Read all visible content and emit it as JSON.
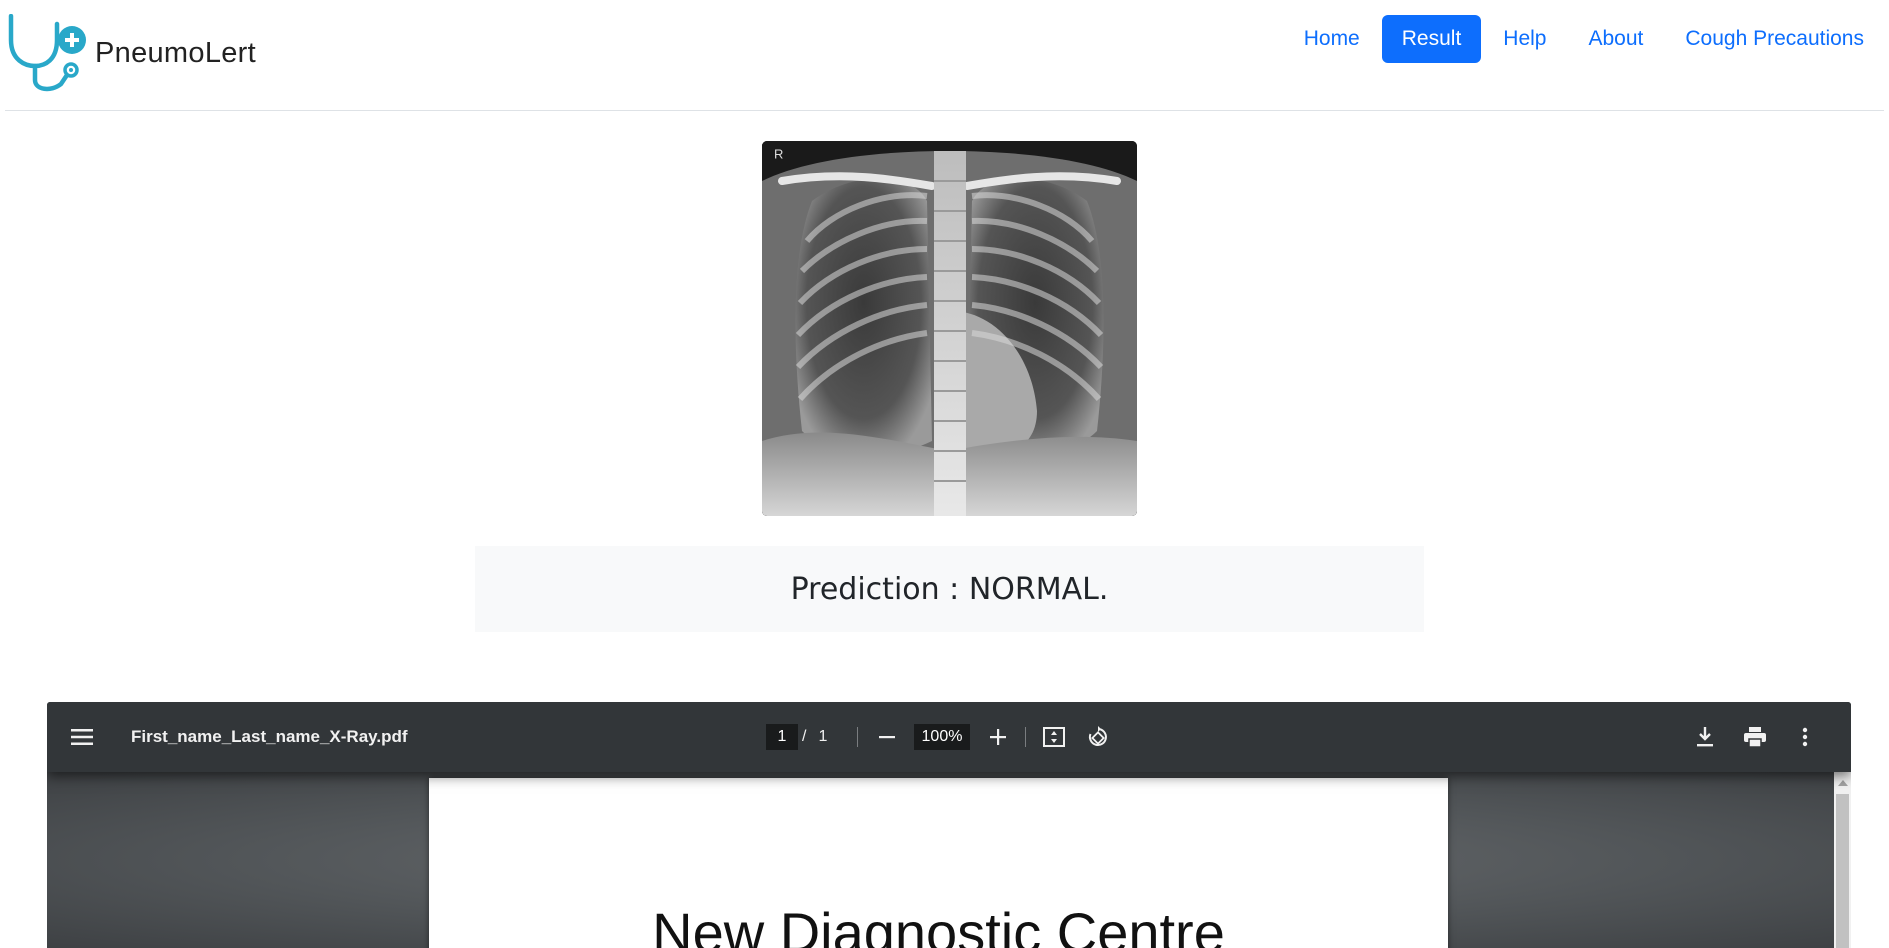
{
  "brand": {
    "name": "PneumoLert",
    "logo_icon": "stethoscope-plus-icon",
    "logo_color": "#29a8c9"
  },
  "nav": {
    "items": [
      {
        "label": "Home",
        "active": false
      },
      {
        "label": "Result",
        "active": true
      },
      {
        "label": "Help",
        "active": false
      },
      {
        "label": "About",
        "active": false
      },
      {
        "label": "Cough Precautions",
        "active": false
      }
    ],
    "accent": "#0d6efd"
  },
  "xray": {
    "marker": "R"
  },
  "prediction": {
    "text": "Prediction : NORMAL."
  },
  "pdf_viewer": {
    "filename": "First_name_Last_name_X-Ray.pdf",
    "current_page": "1",
    "total_pages": "1",
    "zoom": "100%",
    "page_heading": "New Diagnostic Centre",
    "icons": [
      "menu-icon",
      "zoom-out-icon",
      "zoom-in-icon",
      "fit-page-icon",
      "rotate-icon",
      "download-icon",
      "print-icon",
      "more-icon"
    ]
  }
}
